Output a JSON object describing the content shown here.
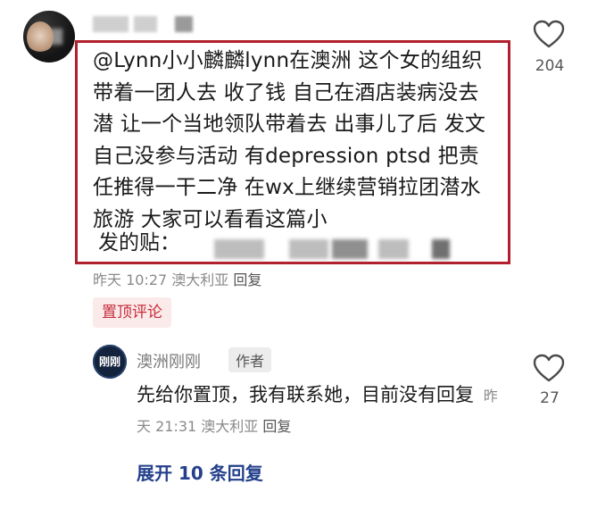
{
  "top_comment": {
    "text": "@Lynn小小麟麟lynn在澳洲 这个女的组织带着一团人去 收了钱 自己在酒店装病没去潜 让一个当地领队带着去 出事儿了后 发文自己没参与活动 有depression ptsd 把责任推得一干二净 在wx上继续营销拉团潜水旅游 大家可以看看这篇小",
    "text_tail": "发的贴：",
    "timestamp": "昨天 10:27",
    "location": "澳大利亚",
    "reply_label": "回复",
    "pinned_badge": "置顶评论",
    "like_count": "204"
  },
  "reply": {
    "avatar_text": "刚刚",
    "author_name": "澳洲刚刚",
    "author_badge": "作者",
    "text": "先给你置顶，我有联系她，目前没有回复",
    "timestamp": "昨天 21:31",
    "location": "澳大利亚",
    "reply_label": "回复",
    "like_count": "27"
  },
  "expand_label": "展开 10 条回复",
  "colors": {
    "highlight_border": "#b1202c",
    "pinned_text": "#c62d3a",
    "pinned_bg": "#fbeaea",
    "expand_link": "#24408c"
  },
  "icons": [
    "heart-outline-icon"
  ]
}
